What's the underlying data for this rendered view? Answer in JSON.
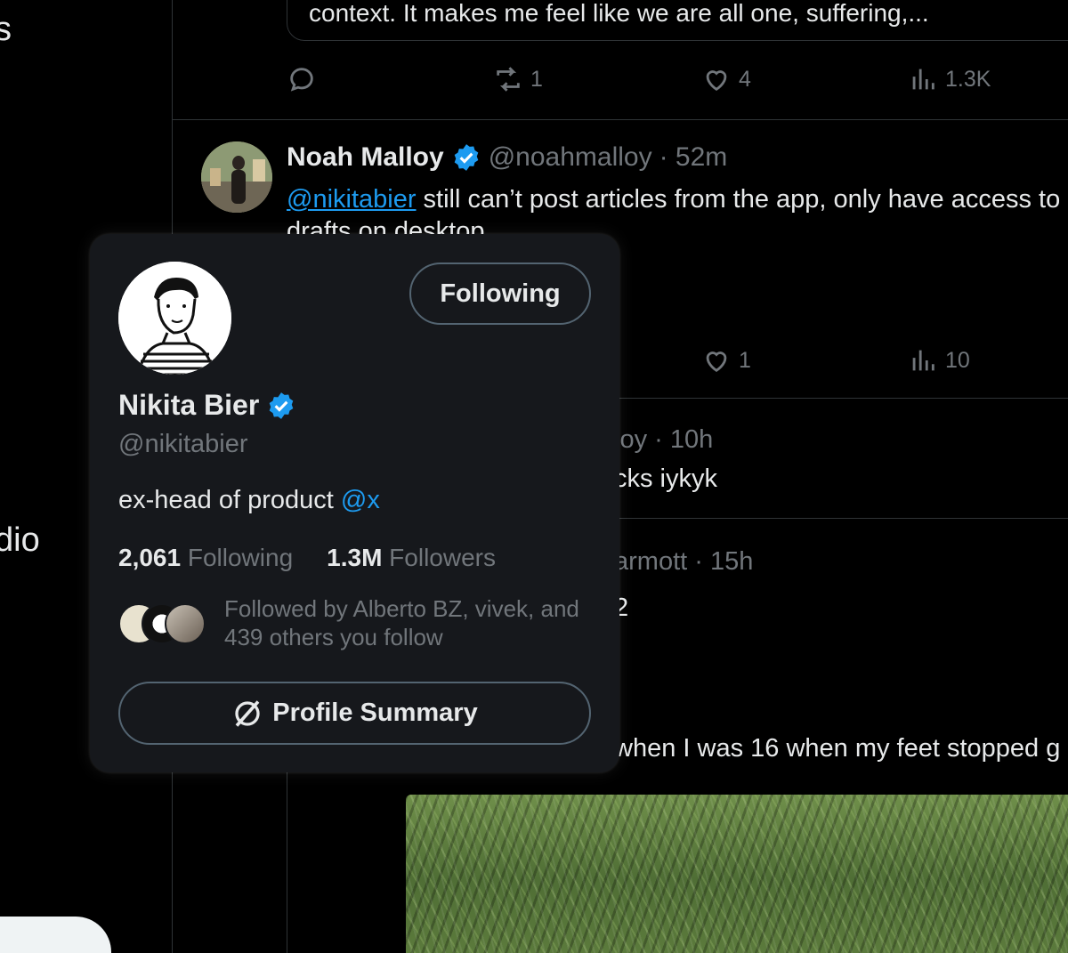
{
  "sidebar": {
    "top_fragment": "s",
    "mid_fragment": "dio"
  },
  "quoted_tweet": {
    "text": "context. It makes me feel like we are all one, suffering,..."
  },
  "tweet1_actions": {
    "reply_count": "",
    "retweet_count": "1",
    "like_count": "4",
    "views_count": "1.3K"
  },
  "tweet2": {
    "name": "Noah Malloy",
    "handle": "@noahmalloy",
    "time": "· 52m",
    "mention": "@nikitabier",
    "text": " still can’t post articles from the app, only have access to",
    "text_line2": "drafts on desktop",
    "like_count": "1",
    "views_count": "10"
  },
  "tweet3": {
    "meta_fragment": "loy · 10h",
    "text_fragment": "cks iykyk"
  },
  "tweet4": {
    "meta_fragment": "armott · 15h",
    "text_fragment": "2",
    "body_fragment": "when I was 16 when my feet stopped g"
  },
  "hover_card": {
    "follow_button": "Following",
    "name": "Nikita Bier",
    "handle": "@nikitabier",
    "bio_text": "ex-head of product ",
    "bio_link": "@x",
    "following_count": "2,061",
    "following_label": "Following",
    "followers_count": "1.3M",
    "followers_label": "Followers",
    "followed_by": "Followed by Alberto BZ, vivek, and 439 others you follow",
    "summary_button": "Profile Summary"
  },
  "colors": {
    "background": "#000000",
    "card": "#16181c",
    "accent": "#1d9bf0",
    "muted": "#71767b",
    "border": "#2f3336"
  },
  "icons": [
    "reply-icon",
    "retweet-icon",
    "like-icon",
    "views-icon",
    "verified-badge-icon",
    "grok-icon"
  ]
}
